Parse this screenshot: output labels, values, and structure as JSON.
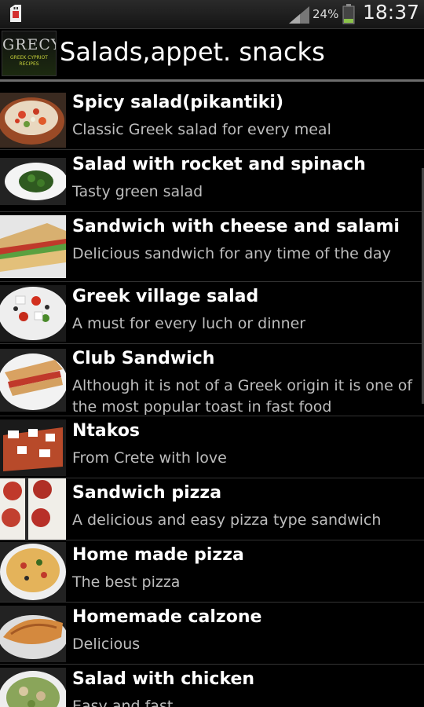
{
  "status_bar": {
    "battery_percent": "24%",
    "time": "18:37",
    "icons": [
      "sim-card-icon",
      "signal-icon",
      "battery-icon"
    ]
  },
  "action_bar": {
    "logo_text": "GRECY",
    "logo_subtext": "GREEK CYPRIOT RECIPES",
    "title": "Salads,appet. snacks"
  },
  "list": {
    "items": [
      {
        "title": "Spicy salad(pikantiki)",
        "subtitle": "Classic Greek salad for every meal"
      },
      {
        "title": "Salad with rocket and spinach",
        "subtitle": "Tasty green salad"
      },
      {
        "title": "Sandwich with cheese and salami",
        "subtitle": "Delicious sandwich for any time of the day"
      },
      {
        "title": "Greek village salad",
        "subtitle": "A must for every luch or dinner"
      },
      {
        "title": "Club Sandwich",
        "subtitle": "Although it is not of a Greek origin it is one of the most popular toast in fast food"
      },
      {
        "title": "Ntakos",
        "subtitle": "From Crete with love"
      },
      {
        "title": "Sandwich pizza",
        "subtitle": "A delicious and easy pizza type sandwich"
      },
      {
        "title": "Home made pizza",
        "subtitle": "The best pizza"
      },
      {
        "title": "Homemade calzone",
        "subtitle": "Delicious"
      },
      {
        "title": "Salad with chicken",
        "subtitle": "Easy and fast"
      }
    ]
  },
  "colors": {
    "background": "#000000",
    "title_text": "#ffffff",
    "subtitle_text": "#bdbdbd",
    "divider": "#333333",
    "battery_green": "#8bc34a",
    "sim_red": "#d32f2f"
  }
}
